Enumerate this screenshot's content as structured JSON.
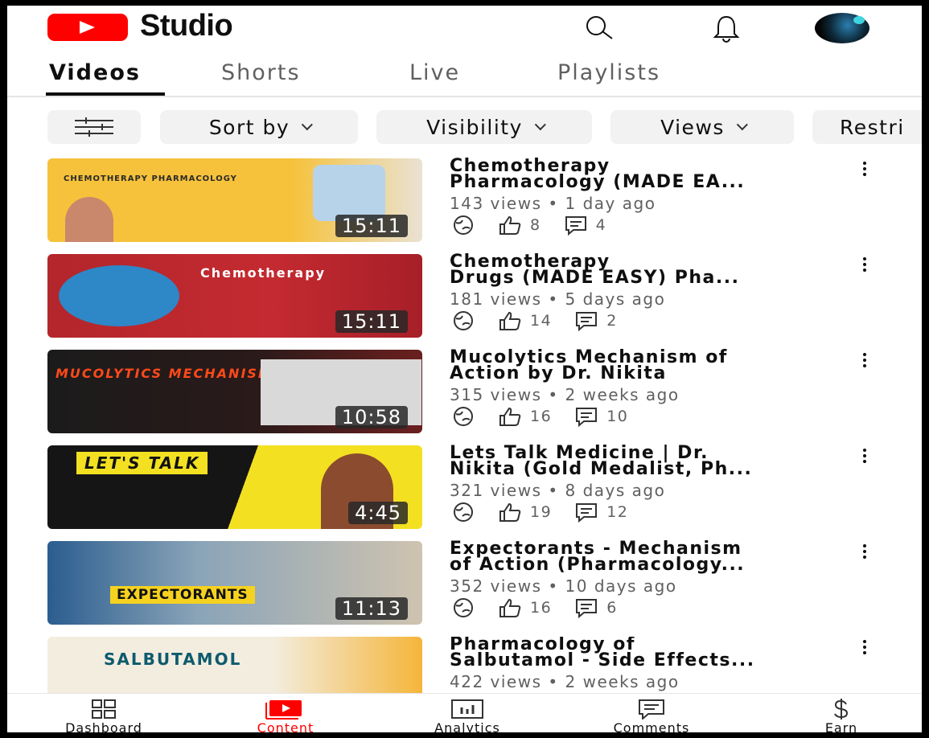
{
  "app": {
    "name": "Studio"
  },
  "colors": {
    "brand_red": "#ff0000",
    "text_primary": "#0f0f0f",
    "text_secondary": "#606060",
    "chip_bg": "#f2f2f2"
  },
  "tabs": [
    {
      "label": "Videos",
      "active": true
    },
    {
      "label": "Shorts",
      "active": false
    },
    {
      "label": "Live",
      "active": false
    },
    {
      "label": "Playlists",
      "active": false
    }
  ],
  "filters": {
    "filter_icon": "tune-icon",
    "chips": [
      "Sort by",
      "Visibility",
      "Views",
      "Restri"
    ]
  },
  "videos": [
    {
      "title1": "Chemotherapy",
      "title2": "Pharmacology (MADE EA...",
      "meta": "143 views • 1 day ago",
      "likes": "8",
      "comments": "4",
      "duration": "15:11",
      "thumb_label": "CHEMOTHERAPY PHARMACOLOGY"
    },
    {
      "title1": "Chemotherapy",
      "title2": "Drugs (MADE EASY) Pha...",
      "meta": "181 views • 5 days ago",
      "likes": "14",
      "comments": "2",
      "duration": "15:11",
      "thumb_label": "Chemotherapy"
    },
    {
      "title1": "Mucolytics Mechanism of",
      "title2": "Action by Dr. Nikita",
      "meta": "315 views • 2 weeks ago",
      "likes": "16",
      "comments": "10",
      "duration": "10:58",
      "thumb_label": "MUCOLYTICS MECHANISM"
    },
    {
      "title1": "Lets Talk Medicine | Dr.",
      "title2": "Nikita (Gold Medalist, Ph...",
      "meta": "321 views • 8 days ago",
      "likes": "19",
      "comments": "12",
      "duration": "4:45",
      "thumb_label": "LET'S TALK"
    },
    {
      "title1": "Expectorants - Mechanism",
      "title2": "of Action (Pharmacology...",
      "meta": "352 views • 10 days ago",
      "likes": "16",
      "comments": "6",
      "duration": "11:13",
      "thumb_label": "EXPECTORANTS"
    },
    {
      "title1": "Pharmacology of",
      "title2": "Salbutamol - Side Effects...",
      "meta": "422 views • 2 weeks ago",
      "likes": "",
      "comments": "",
      "duration": "",
      "thumb_label": "SALBUTAMOL"
    }
  ],
  "bottom_nav": [
    {
      "label": "Dashboard",
      "icon": "dashboard-icon",
      "active": false
    },
    {
      "label": "Content",
      "icon": "content-icon",
      "active": true
    },
    {
      "label": "Analytics",
      "icon": "analytics-icon",
      "active": false
    },
    {
      "label": "Comments",
      "icon": "comments-icon",
      "active": false
    },
    {
      "label": "Earn",
      "icon": "dollar-icon",
      "active": false
    }
  ]
}
